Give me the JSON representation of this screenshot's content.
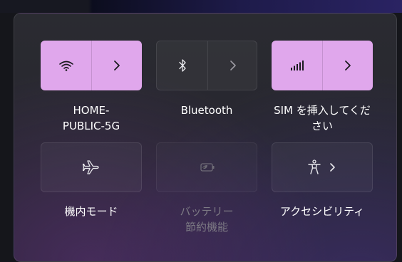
{
  "quick_settings": {
    "tiles": [
      {
        "label": "HOME-\nPUBLIC-5G",
        "icon": "wifi-icon",
        "state": "on",
        "has_expand": true
      },
      {
        "label": "Bluetooth",
        "icon": "bluetooth-icon",
        "state": "off",
        "has_expand": true
      },
      {
        "label": "SIM を挿入してくだ\nさい",
        "icon": "cellular-icon",
        "state": "on",
        "has_expand": true
      },
      {
        "label": "機内モード",
        "icon": "airplane-icon",
        "state": "off",
        "has_expand": false
      },
      {
        "label": "バッテリー\n節約機能",
        "icon": "battery-saver-icon",
        "state": "disabled",
        "has_expand": false
      },
      {
        "label": "アクセシビリティ",
        "icon": "accessibility-icon",
        "state": "off",
        "has_expand": true
      }
    ]
  },
  "colors": {
    "accent": "#e0a7ec",
    "label": "#ffffff",
    "label_disabled": "#7d7a84"
  }
}
